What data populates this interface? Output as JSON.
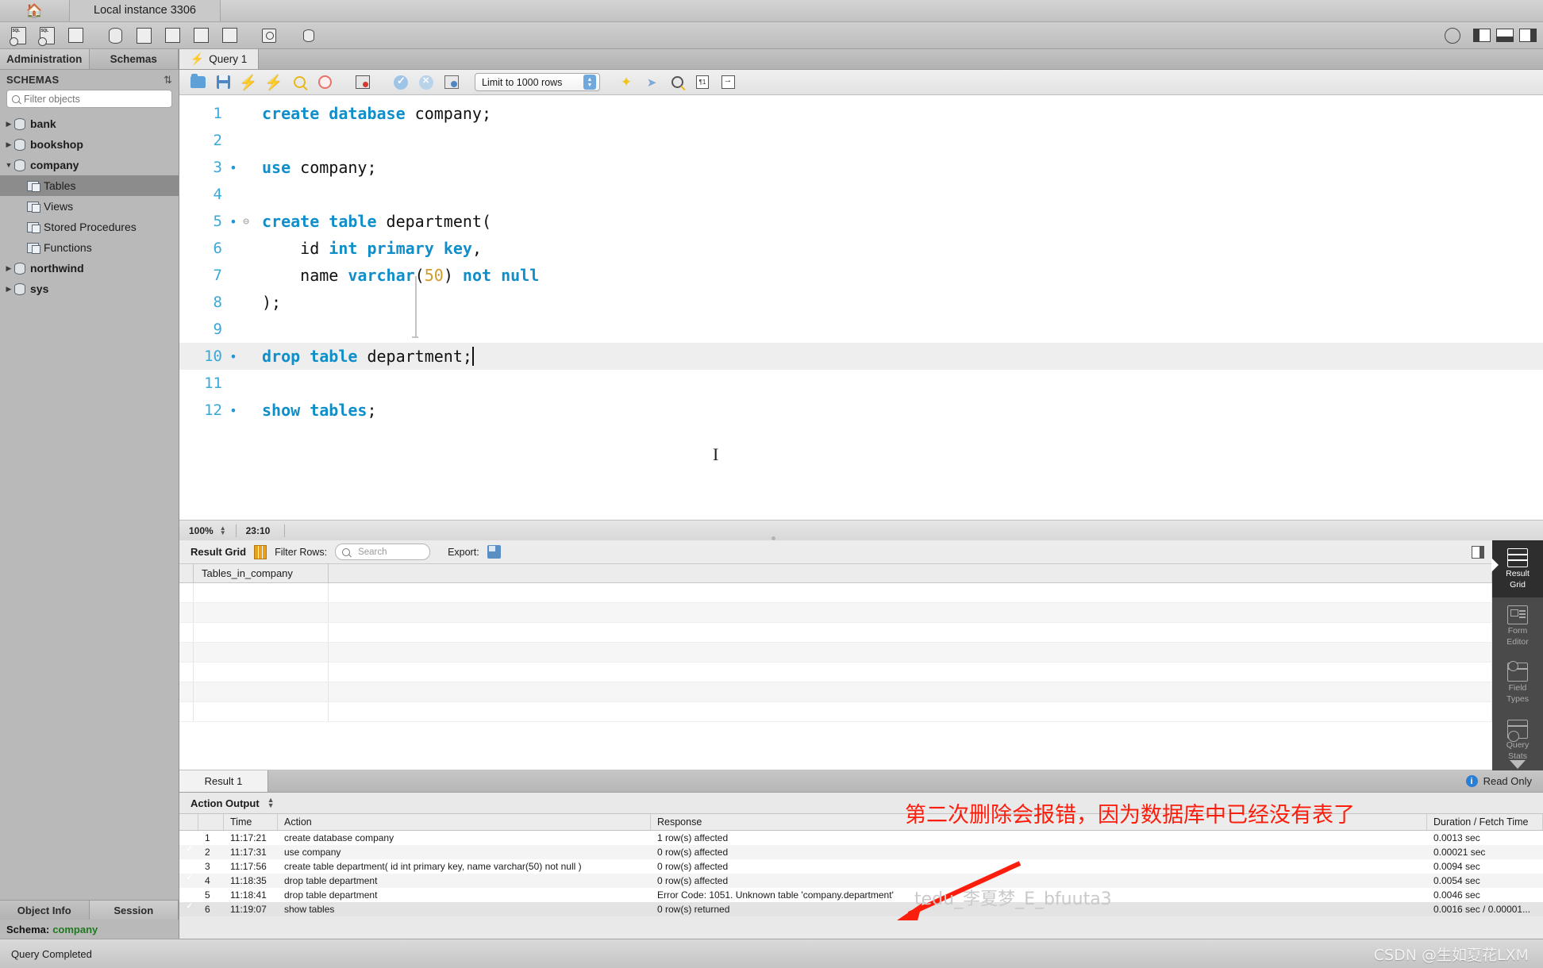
{
  "titlebar": {
    "home_icon": "home-icon",
    "instance_tab": "Local instance 3306"
  },
  "toolbar": {
    "icons": [
      "new-sql-tab-icon",
      "open-sql-script-icon",
      "connection-info-icon",
      "new-schema-icon",
      "new-table-icon",
      "new-view-icon",
      "new-stored-procedure-icon",
      "new-function-icon",
      "search-data-icon",
      "reconnect-dbms-icon"
    ],
    "right_icons": [
      "help-icon",
      "toggle-sidebar-icon",
      "toggle-output-icon",
      "toggle-secondary-sidebar-icon"
    ]
  },
  "sidebar": {
    "tabs": [
      {
        "label": "Administration",
        "active": false
      },
      {
        "label": "Schemas",
        "active": true
      }
    ],
    "header": "SCHEMAS",
    "refresh_icon": "refresh-icon",
    "filter": {
      "value": "",
      "placeholder": "Filter objects",
      "icon": "search-icon"
    },
    "tree": [
      {
        "label": "bank",
        "type": "schema",
        "expanded": false,
        "selected": false
      },
      {
        "label": "bookshop",
        "type": "schema",
        "expanded": false,
        "selected": false
      },
      {
        "label": "company",
        "type": "schema",
        "expanded": true,
        "selected": false
      },
      {
        "label": "Tables",
        "type": "folder",
        "child": true,
        "selected": true
      },
      {
        "label": "Views",
        "type": "folder",
        "child": true,
        "selected": false
      },
      {
        "label": "Stored Procedures",
        "type": "folder",
        "child": true,
        "selected": false
      },
      {
        "label": "Functions",
        "type": "folder",
        "child": true,
        "selected": false
      },
      {
        "label": "northwind",
        "type": "schema",
        "expanded": false,
        "selected": false
      },
      {
        "label": "sys",
        "type": "schema",
        "expanded": false,
        "selected": false
      }
    ],
    "bottom_tabs": [
      {
        "label": "Object Info",
        "active": true
      },
      {
        "label": "Session",
        "active": false
      }
    ],
    "object_info": {
      "key": "Schema:",
      "value": "company"
    }
  },
  "query_tab": {
    "label": "Query 1",
    "icon": "lightning-icon"
  },
  "editor_toolbar": {
    "icons": [
      "open-script-icon",
      "save-script-icon",
      "execute-icon",
      "execute-current-statement-icon",
      "explain-icon",
      "stop-icon",
      "toggle-stop-on-error-icon",
      "commit-icon",
      "rollback-icon",
      "autocommit-icon"
    ],
    "limit_select": {
      "value": "Limit to 1000 rows"
    },
    "trailing_icons": [
      "beautify-icon",
      "find-icon",
      "toggle-invisible-chars-icon",
      "wrap-lines-icon"
    ]
  },
  "editor": {
    "lines": [
      {
        "num": "1",
        "marker": "",
        "fold": "",
        "html": "<span class='kw'>create</span> <span class='kw'>database</span> company;",
        "highlight": false
      },
      {
        "num": "2",
        "marker": "",
        "fold": "",
        "html": "",
        "highlight": false
      },
      {
        "num": "3",
        "marker": "•",
        "fold": "",
        "html": "<span class='kw'>use</span> company;",
        "highlight": false
      },
      {
        "num": "4",
        "marker": "",
        "fold": "",
        "html": "",
        "highlight": false
      },
      {
        "num": "5",
        "marker": "•",
        "fold": "⊖",
        "html": "<span class='kw'>create</span> <span class='kw'>table</span> department(",
        "highlight": false
      },
      {
        "num": "6",
        "marker": "",
        "fold": "",
        "html": "    id <span class='kw'>int</span> <span class='kw'>primary</span> <span class='kw'>key</span>,",
        "highlight": false
      },
      {
        "num": "7",
        "marker": "",
        "fold": "",
        "html": "    name <span class='kw'>varchar</span>(<span class='num'>50</span>) <span class='kw'>not</span> <span class='kw'>null</span>",
        "highlight": false
      },
      {
        "num": "8",
        "marker": "",
        "fold": "",
        "html": ");",
        "highlight": false
      },
      {
        "num": "9",
        "marker": "",
        "fold": "",
        "html": "",
        "highlight": false
      },
      {
        "num": "10",
        "marker": "•",
        "fold": "",
        "html": "<span class='kw'>drop</span> <span class='kw'>table</span> department;<span class='caret'></span>",
        "highlight": true
      },
      {
        "num": "11",
        "marker": "",
        "fold": "",
        "html": "",
        "highlight": false
      },
      {
        "num": "12",
        "marker": "•",
        "fold": "",
        "html": "<span class='kw'>show</span> <span class='kw'>tables</span>;",
        "highlight": false
      }
    ],
    "text_cursor": "I",
    "play_button": "run-overlay-button"
  },
  "editor_status": {
    "zoom": "100%",
    "time": "23:10"
  },
  "result_toolbar": {
    "result_grid_label": "Result Grid",
    "grid_icon": "grid-view-icon",
    "filter_rows_label": "Filter Rows:",
    "filter_placeholder": "Search",
    "filter_value": "",
    "export_label": "Export:",
    "export_icon": "export-icon",
    "panel_toggle_icon": "toggle-field-panel-icon"
  },
  "result_grid": {
    "columns": [
      "Tables_in_company",
      ""
    ],
    "rows": [
      [],
      [],
      [],
      [],
      [],
      [],
      []
    ]
  },
  "right_tabs": [
    {
      "label": "Result\nGrid",
      "line1": "Result",
      "line2": "Grid",
      "active": true,
      "icon": "result-grid-icon"
    },
    {
      "label": "Form Editor",
      "line1": "Form",
      "line2": "Editor",
      "active": false,
      "icon": "form-editor-icon"
    },
    {
      "label": "Field Types",
      "line1": "Field",
      "line2": "Types",
      "active": false,
      "icon": "field-types-icon"
    },
    {
      "label": "Query Stats",
      "line1": "Query",
      "line2": "Stats",
      "active": false,
      "icon": "query-stats-icon"
    }
  ],
  "result_tabbar": {
    "tab": "Result 1",
    "read_only": "Read Only",
    "info_icon": "info-icon"
  },
  "action_output": {
    "title": "Action Output",
    "stepper_icon": "stepper-icon",
    "columns": [
      "",
      "",
      "Time",
      "Action",
      "Response",
      "Duration / Fetch Time"
    ],
    "rows": [
      {
        "status": "ok",
        "n": "1",
        "time": "11:17:21",
        "action": "create database company",
        "response": "1 row(s) affected",
        "duration": "0.0013 sec"
      },
      {
        "status": "ok",
        "n": "2",
        "time": "11:17:31",
        "action": "use company",
        "response": "0 row(s) affected",
        "duration": "0.00021 sec"
      },
      {
        "status": "ok",
        "n": "3",
        "time": "11:17:56",
        "action": "create table department(  id int primary key,    name varchar(50) not null )",
        "response": "0 row(s) affected",
        "duration": "0.0094 sec"
      },
      {
        "status": "ok",
        "n": "4",
        "time": "11:18:35",
        "action": "drop table department",
        "response": "0 row(s) affected",
        "duration": "0.0054 sec"
      },
      {
        "status": "error",
        "n": "5",
        "time": "11:18:41",
        "action": "drop table department",
        "response": "Error Code: 1051. Unknown table 'company.department'",
        "duration": "0.0046 sec"
      },
      {
        "status": "ok",
        "n": "6",
        "time": "11:19:07",
        "action": "show tables",
        "response": "0 row(s) returned",
        "duration": "0.0016 sec / 0.00001..."
      }
    ]
  },
  "statusbar": {
    "message": "Query Completed",
    "watermark": "CSDN @生如夏花LXM"
  },
  "annotations": {
    "note": "第二次删除会报错，因为数据库中已经没有表了",
    "note_color": "#fc1e0d",
    "arrow": "red-arrow-annotation",
    "watermark": "tedu_李夏梦_E_bfuuta3"
  }
}
